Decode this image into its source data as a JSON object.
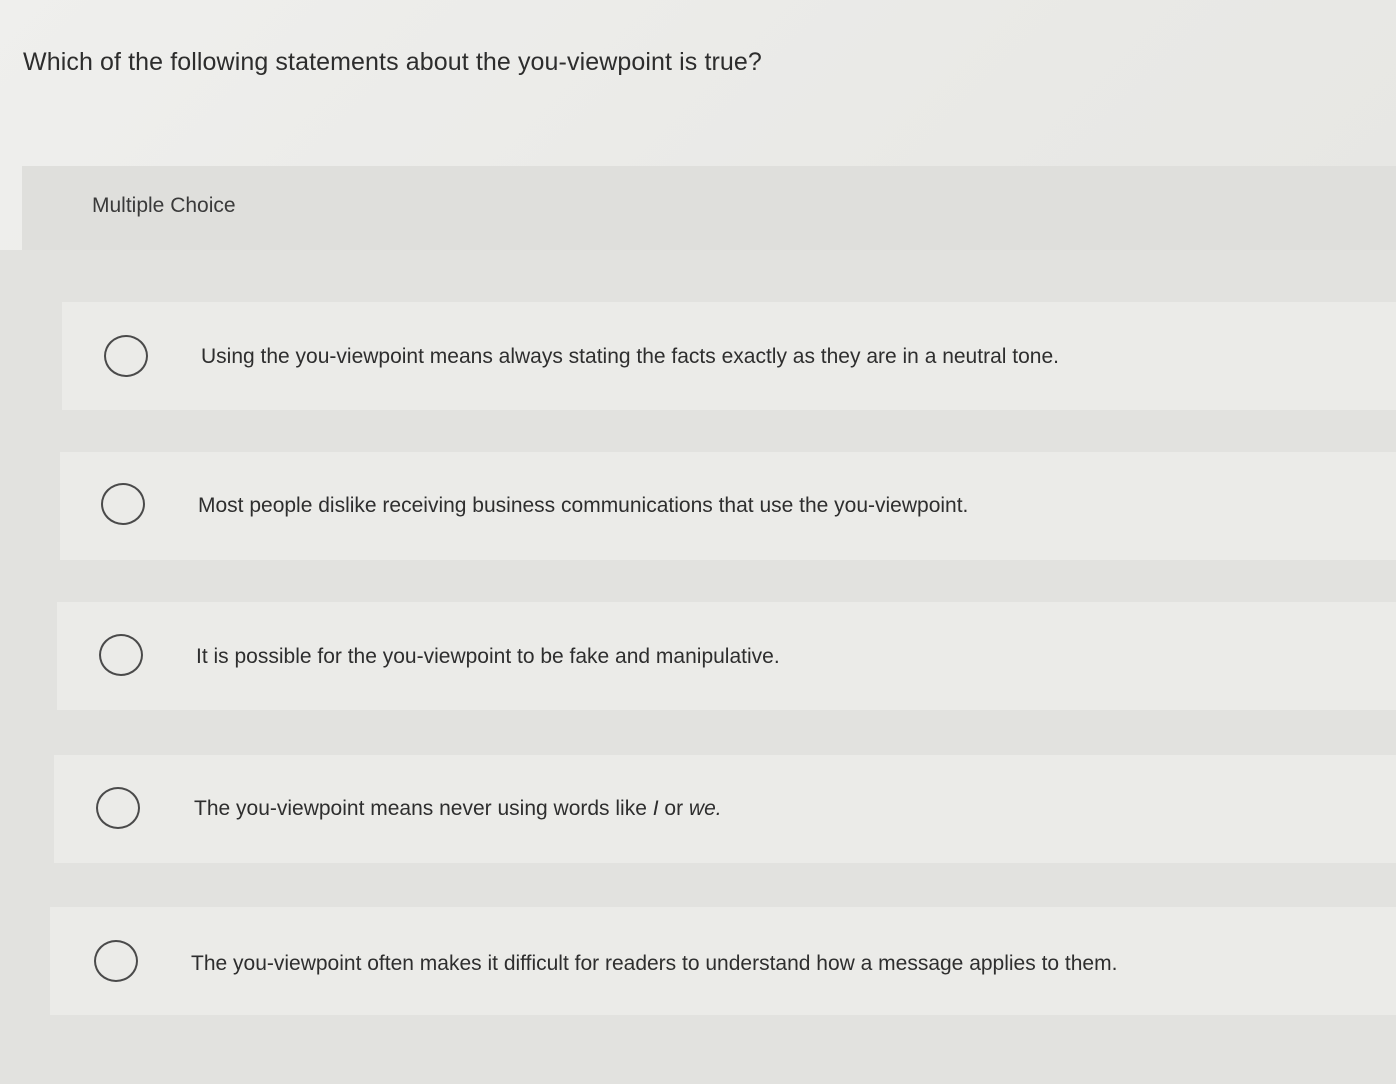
{
  "question": {
    "text": "Which of the following statements about the you-viewpoint is true?"
  },
  "section": {
    "type_label": "Multiple Choice"
  },
  "options": [
    {
      "text": "Using the you-viewpoint means always stating the facts exactly as they are in a neutral tone.",
      "selected": false
    },
    {
      "text": "Most people dislike receiving business communications that use the you-viewpoint.",
      "selected": false
    },
    {
      "text": "It is possible for the you-viewpoint to be fake and manipulative.",
      "selected": false
    },
    {
      "text_before": "The you-viewpoint means never using words like ",
      "italic_1": "I",
      "text_mid": " or ",
      "italic_2": "we.",
      "selected": false
    },
    {
      "text": "The you-viewpoint often makes it difficult for readers to understand how a message applies to them.",
      "selected": false
    }
  ]
}
